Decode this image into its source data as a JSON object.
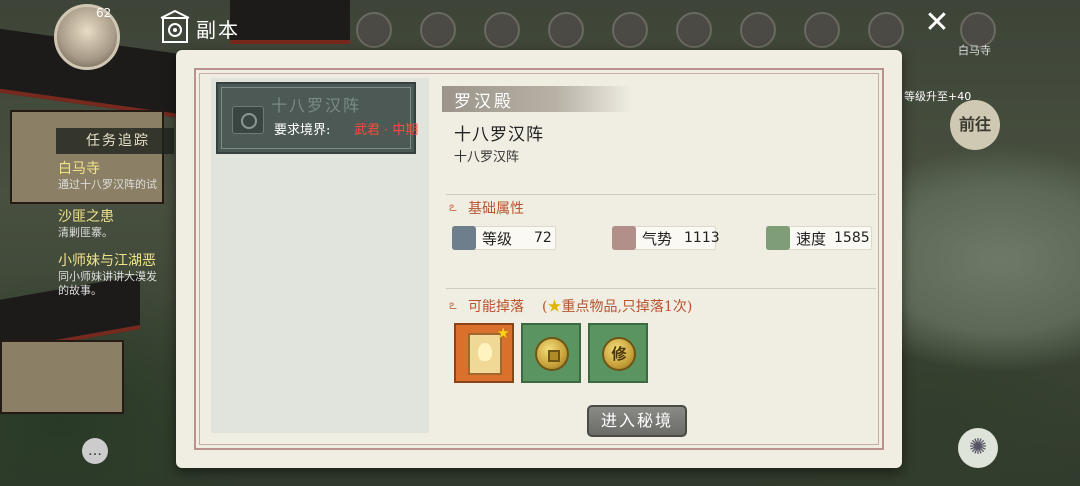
{
  "header": {
    "title": "副本",
    "close_symbol": "✕"
  },
  "player": {
    "level": "62"
  },
  "top_menu": {
    "last_label": "白马寺"
  },
  "task_panel": {
    "heading": "任务追踪",
    "items": [
      {
        "title": "白马寺",
        "desc": "通过十八罗汉阵的试"
      },
      {
        "title": "沙匪之患",
        "desc": "清剿匪寨。"
      },
      {
        "title": "小师妹与江湖恶",
        "desc": "同小师妹讲讲大漠发"
      },
      {
        "title": "",
        "desc": "的故事。"
      }
    ]
  },
  "right_side": {
    "upgrade_text": "等级升至+40",
    "goto_label": "前往"
  },
  "dungeon_list": [
    {
      "name": "十八罗汉阵",
      "req_label": "要求境界:",
      "req_value": "武君 · 中期"
    }
  ],
  "detail": {
    "location": "罗汉殿",
    "name": "十八罗汉阵",
    "subtitle": "十八罗汉阵",
    "attributes_title": "基础属性",
    "attributes": [
      {
        "label": "等级",
        "value": "72",
        "icon": "level-icon"
      },
      {
        "label": "气势",
        "value": "1113",
        "icon": "momentum-icon"
      },
      {
        "label": "速度",
        "value": "1585",
        "icon": "speed-icon"
      }
    ],
    "drops_title": "可能掉落",
    "drops_note_open": "(",
    "drops_note_star": "★",
    "drops_note": "重点物品,只掉落1次)",
    "drops": [
      {
        "icon": "manual-book-icon",
        "rarity": "orange",
        "key_item": true
      },
      {
        "icon": "copper-coin-icon",
        "rarity": "green",
        "key_item": false
      },
      {
        "icon": "cultivation-coin-icon",
        "rarity": "green",
        "key_item": false,
        "glyph": "修"
      }
    ],
    "enter_button": "进入秘境"
  },
  "colors": {
    "accent_red": "#ff4a3c",
    "section_orange": "#b8542e",
    "dialog_bg": "#f0ede3"
  }
}
